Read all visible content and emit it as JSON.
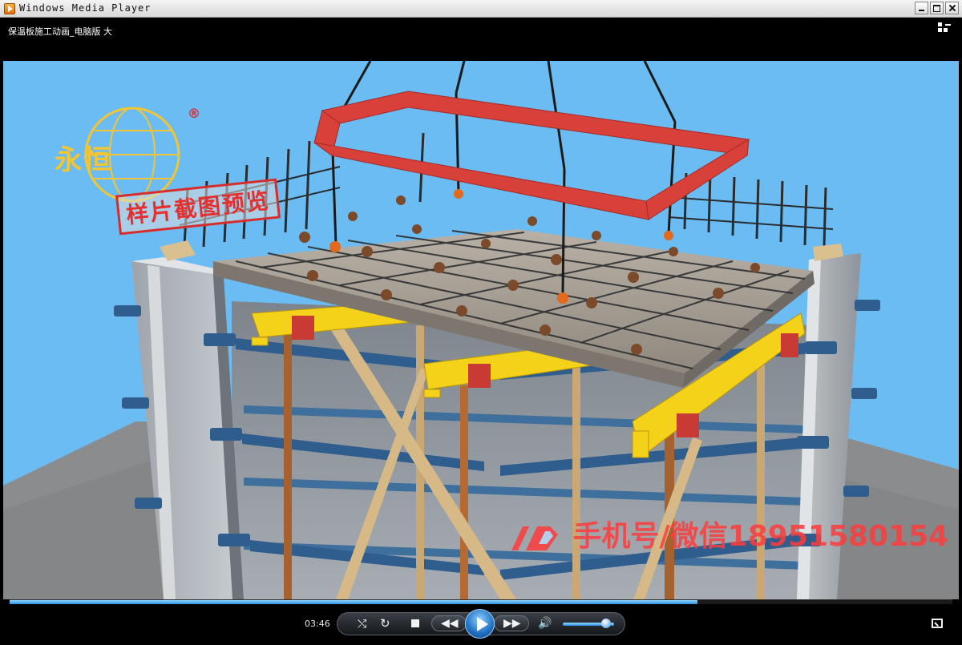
{
  "window": {
    "title": "Windows Media Player",
    "buttons": [
      "minimize",
      "maximize",
      "close"
    ]
  },
  "media": {
    "title": "保温板施工动画_电脑版 大",
    "switch_view_icon": "switch-to-library-icon"
  },
  "video_overlay": {
    "logo_text": "永恒",
    "logo_mark": "®",
    "sample_stamp": "样片截图预览",
    "watermark": "手机号/微信18951580154"
  },
  "controls": {
    "current_time": "03:46",
    "seek_progress": 0.73,
    "volume_level": 0.85,
    "icons": [
      "shuffle-icon",
      "repeat-icon",
      "stop-icon",
      "previous-icon",
      "play-icon",
      "next-icon",
      "volume-icon",
      "fullscreen-icon"
    ]
  },
  "colors": {
    "sky": "#6cbcf4",
    "beam_yellow": "#f5d21a",
    "frame_red": "#d8403a",
    "accent_blue": "#2f8fe0"
  }
}
